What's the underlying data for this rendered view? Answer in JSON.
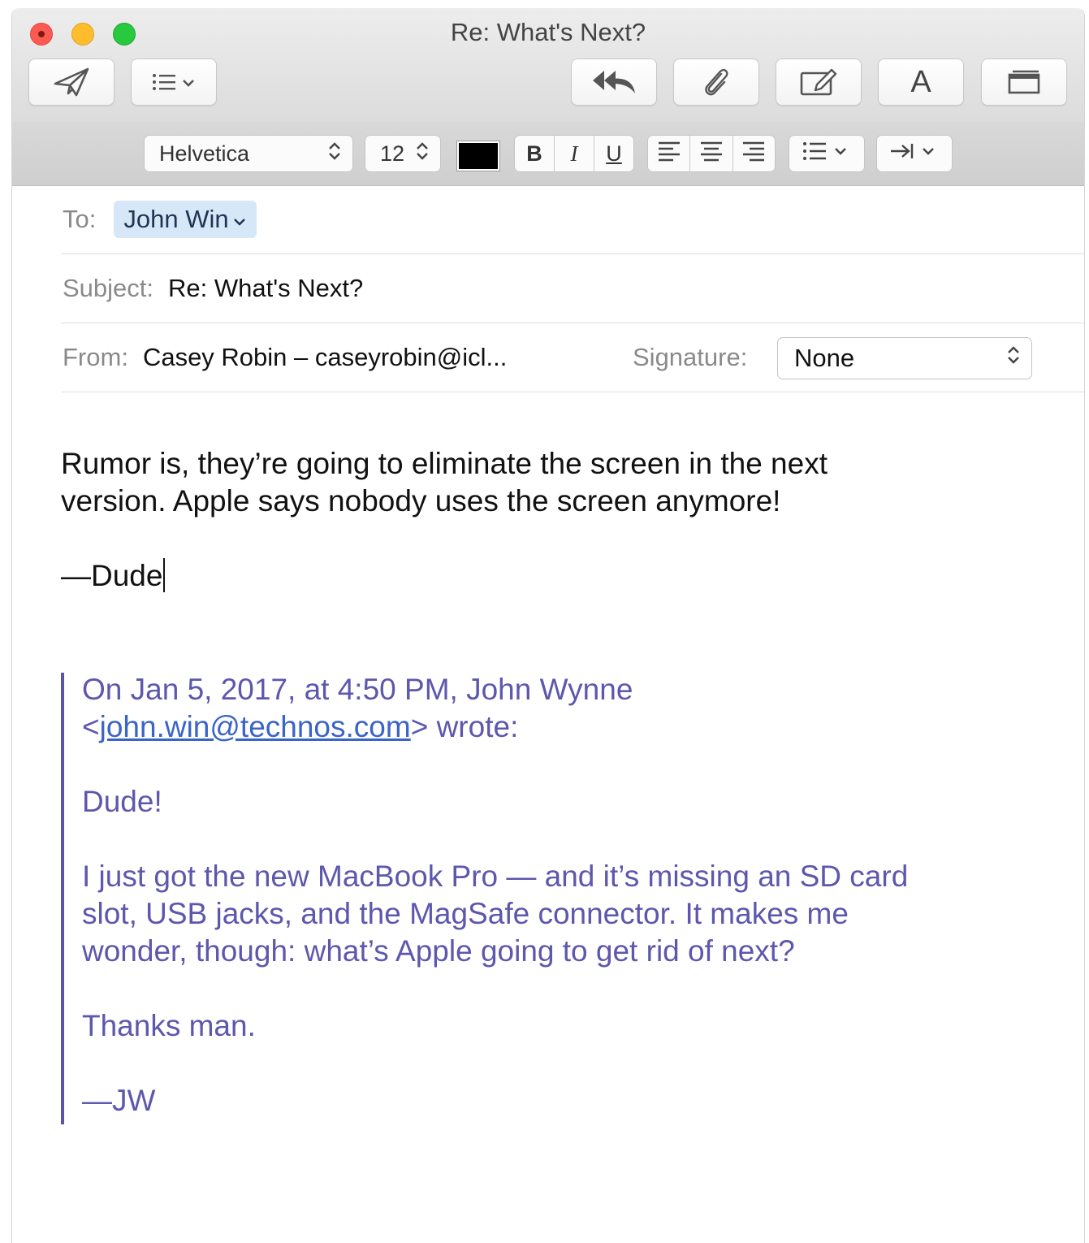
{
  "window": {
    "title": "Re: What's Next?"
  },
  "toolbar": {
    "send_icon": "paper-plane-icon",
    "header_fields_icon": "list-dropdown-icon",
    "include_original_icon": "reply-all-icon",
    "attach_icon": "paperclip-icon",
    "markup_icon": "photo-browser-icon",
    "format_icon": "font-icon",
    "format_label": "A",
    "stationery_icon": "window-icon"
  },
  "format_bar": {
    "font": "Helvetica",
    "size": "12",
    "color": "#000000",
    "bold": "B",
    "italic": "I",
    "underline": "U"
  },
  "header": {
    "to_label": "To:",
    "to_recipient": "John Win",
    "subject_label": "Subject:",
    "subject_value": "Re: What's Next?",
    "from_label": "From:",
    "from_value": "Casey Robin – caseyrobin@icl...",
    "signature_label": "Signature:",
    "signature_value": "None"
  },
  "message": {
    "line1": "Rumor is, they’re going to eliminate the screen in the next",
    "line2": "version. Apple says nobody uses the screen anymore!",
    "signoff": "—Dude"
  },
  "quoted": {
    "attribution_line1": "On Jan 5, 2017, at 4:50 PM, John Wynne",
    "attribution_open": "<",
    "attribution_email": "john.win@technos.com",
    "attribution_close": "> wrote:",
    "greeting": "Dude!",
    "para_line1": "I just got the new MacBook Pro — and it’s missing an SD card",
    "para_line2": "slot, USB jacks, and the MagSafe connector. It makes me",
    "para_line3": "wonder, though: what’s Apple going to get rid of next?",
    "thanks": "Thanks man.",
    "signoff": "—JW"
  },
  "colors": {
    "quote_text": "#5d57ad",
    "quote_bar": "#5a55a8",
    "link": "#3b64c7",
    "token_bg": "#d6e7f7"
  }
}
